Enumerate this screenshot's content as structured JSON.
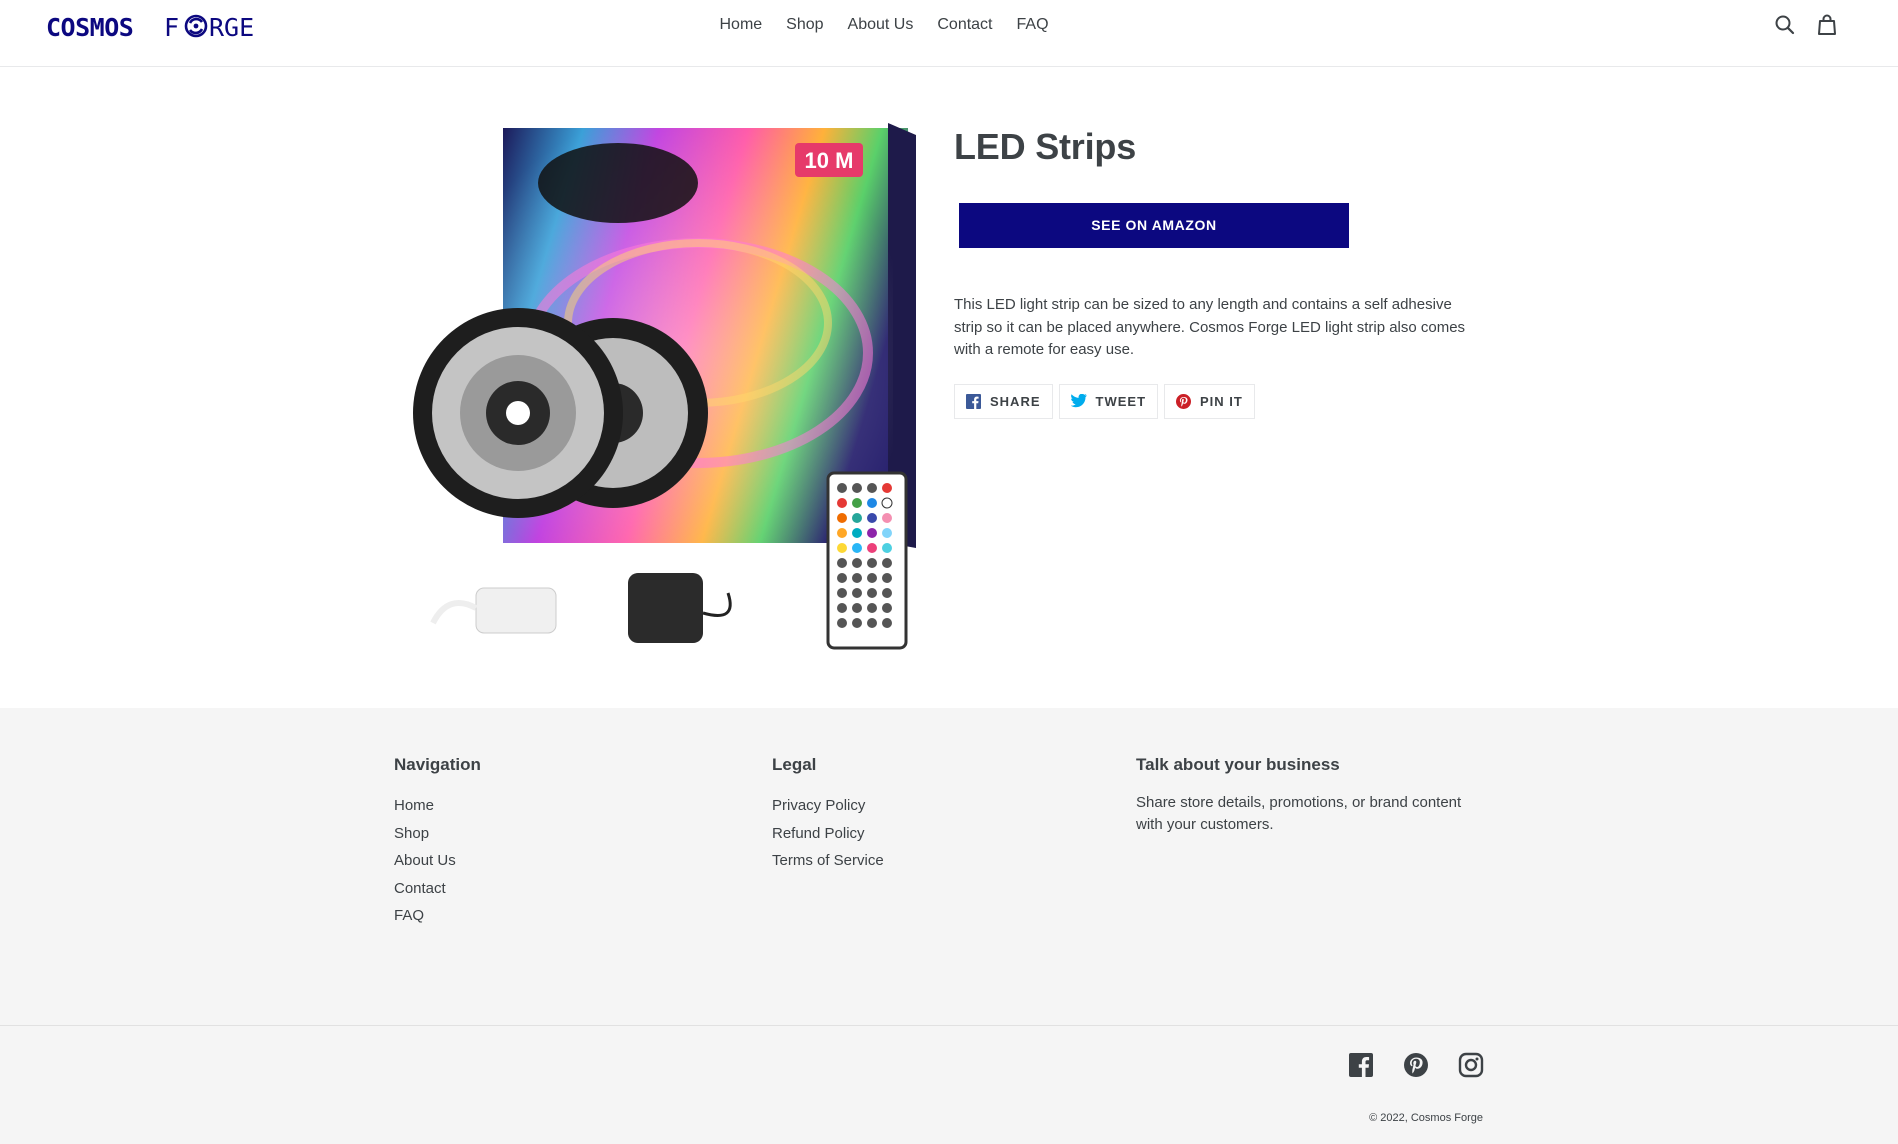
{
  "header": {
    "logo_text": "COSMOS FORGE",
    "nav": [
      {
        "label": "Home"
      },
      {
        "label": "Shop"
      },
      {
        "label": "About Us"
      },
      {
        "label": "Contact"
      },
      {
        "label": "FAQ"
      }
    ],
    "icons": [
      "search-icon",
      "cart-icon"
    ]
  },
  "product": {
    "title": "LED Strips",
    "cta_label": "SEE ON AMAZON",
    "description": "This LED light strip can be sized to any length and contains a self adhesive strip so it can be placed anywhere. Cosmos Forge LED light strip also comes with a remote for easy use.",
    "box_label": "10 M",
    "share": [
      {
        "label": "SHARE",
        "icon": "facebook-icon"
      },
      {
        "label": "TWEET",
        "icon": "twitter-icon"
      },
      {
        "label": "PIN IT",
        "icon": "pinterest-icon"
      }
    ]
  },
  "footer": {
    "navigation": {
      "heading": "Navigation",
      "links": [
        "Home",
        "Shop",
        "About Us",
        "Contact",
        "FAQ"
      ]
    },
    "legal": {
      "heading": "Legal",
      "links": [
        "Privacy Policy",
        "Refund Policy",
        "Terms of Service"
      ]
    },
    "business": {
      "heading": "Talk about your business",
      "text": "Share store details, promotions, or brand content with your customers."
    },
    "social": [
      "facebook-icon",
      "pinterest-icon",
      "instagram-icon"
    ],
    "copyright_prefix": "© 2022,",
    "copyright_name": "Cosmos Forge"
  },
  "colors": {
    "brand_navy": "#0c0880",
    "text": "#3d4246",
    "footer_bg": "#f5f5f5"
  }
}
